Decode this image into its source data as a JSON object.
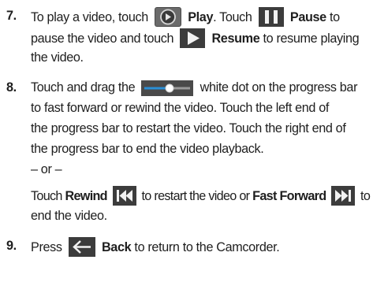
{
  "steps": [
    {
      "number": "7.",
      "a": "To play a video, touch",
      "play_label": "Play",
      "b": ". Touch",
      "pause_label": "Pause",
      "c": "to",
      "d": "pause the video and touch",
      "resume_label": "Resume",
      "e": "to resume playing",
      "f": "the video."
    },
    {
      "number": "8.",
      "a": "Touch and drag the",
      "b": "white dot on the progress bar",
      "c": "to fast forward or rewind the video. Touch the left end of",
      "d": "the progress bar to restart the video. Touch the right end of",
      "e": "the progress bar to end the video playback.",
      "or": "– or –",
      "f": "Touch",
      "rewind_label": "Rewind",
      "g": "to restart the video or",
      "ff_label": "Fast Forward",
      "h": "to",
      "i": "end the video."
    },
    {
      "number": "9.",
      "a": "Press",
      "back_label": "Back",
      "b": "to return to the Camcorder."
    }
  ],
  "icons": {
    "play": "play-circle-icon",
    "pause": "pause-icon",
    "resume": "resume-play-icon",
    "progress": "progress-bar-icon",
    "rewind": "rewind-icon",
    "fast_forward": "fast-forward-icon",
    "back": "back-arrow-icon"
  },
  "colors": {
    "text": "#1e1e1e",
    "icon_dark": "#3a3a3a",
    "progress_blue": "#2a8fd6"
  }
}
